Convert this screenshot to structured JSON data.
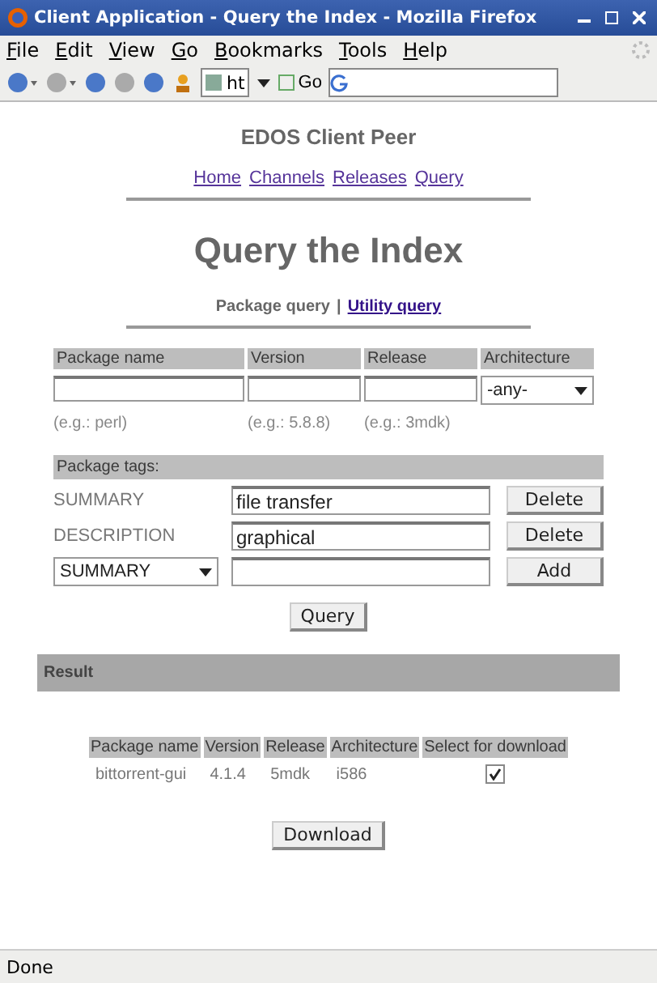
{
  "window": {
    "title": "Client Application - Query the Index - Mozilla Firefox"
  },
  "menu": [
    "File",
    "Edit",
    "View",
    "Go",
    "Bookmarks",
    "Tools",
    "Help"
  ],
  "toolbar": {
    "address": "ht",
    "go": "Go"
  },
  "page": {
    "site_title": "EDOS Client Peer",
    "nav": [
      "Home",
      "Channels",
      "Releases",
      "Query"
    ],
    "heading": "Query the Index",
    "query_tabs": [
      {
        "label": "Package query",
        "selected": true
      },
      {
        "label": "Utility query",
        "selected": false
      }
    ],
    "tab_separator": "|",
    "search": {
      "columns": [
        "Package name",
        "Version",
        "Release",
        "Architecture"
      ],
      "architecture": "-any-",
      "hints": [
        "(e.g.: perl)",
        "(e.g.: 5.8.8)",
        "(e.g.: 3mdk)"
      ]
    },
    "tags": {
      "title": "Package tags:",
      "rows": [
        {
          "name": "SUMMARY",
          "value": "file transfer",
          "button": "Delete"
        },
        {
          "name": "DESCRIPTION",
          "value": "graphical",
          "button": "Delete"
        }
      ],
      "new_tag": {
        "select": "SUMMARY",
        "button": "Add"
      }
    },
    "query_button": "Query",
    "result": {
      "title": "Result",
      "columns": [
        "Package name",
        "Version",
        "Release",
        "Architecture",
        "Select for download"
      ],
      "rows": [
        {
          "cells": [
            "bittorrent-gui",
            "4.1.4",
            "5mdk",
            "i586"
          ],
          "selected": true
        }
      ],
      "download_button": "Download"
    }
  },
  "status_bar": "Done"
}
